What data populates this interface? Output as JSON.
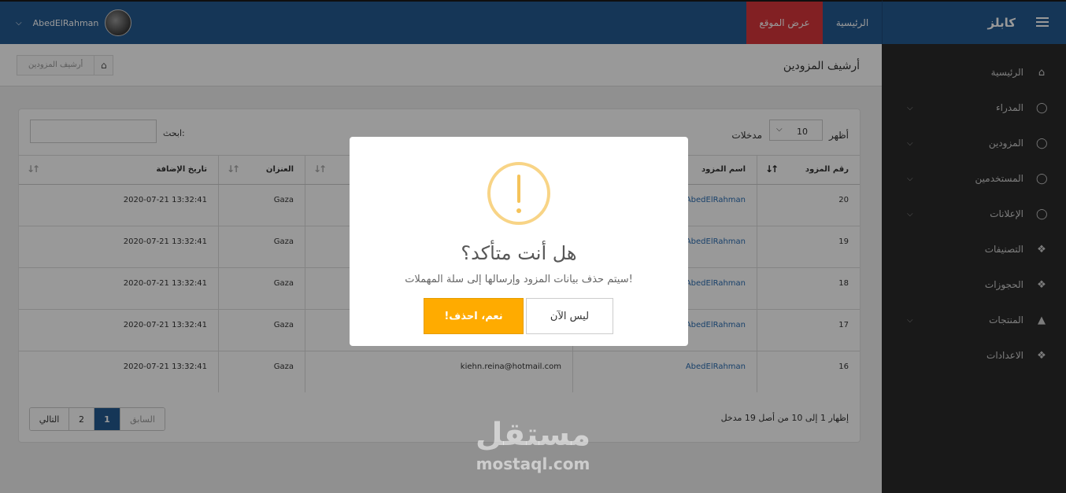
{
  "header": {
    "username": "AbedElRahman",
    "nav_site": "عرض الموقع",
    "nav_home": "الرئيسية"
  },
  "brand": "كابلز",
  "sidebar": {
    "items": [
      {
        "label": "الرئيسية",
        "icon": "home-icon",
        "has_children": false
      },
      {
        "label": "المدراء",
        "icon": "user-icon",
        "has_children": true
      },
      {
        "label": "المزودين",
        "icon": "user-icon",
        "has_children": true
      },
      {
        "label": "المستخدمين",
        "icon": "user-icon",
        "has_children": true
      },
      {
        "label": "الإعلانات",
        "icon": "user-icon",
        "has_children": true
      },
      {
        "label": "التصنيفات",
        "icon": "cubes-icon",
        "has_children": false
      },
      {
        "label": "الحجوزات",
        "icon": "cubes-icon",
        "has_children": false
      },
      {
        "label": "المنتجات",
        "icon": "flask-icon",
        "has_children": true
      },
      {
        "label": "الاعدادات",
        "icon": "cubes-icon",
        "has_children": false
      }
    ]
  },
  "page": {
    "title": "أرشيف المزودين",
    "breadcrumb": "أرشيف المزودين"
  },
  "table_controls": {
    "show_label": "أظهر",
    "page_size": "10",
    "entries_label": "مدخلات",
    "search_label": "ابحث:"
  },
  "table": {
    "headers": [
      "رقم المزود",
      "اسم المزود",
      "",
      "العنزان",
      "تاريخ الإضافة"
    ],
    "rows": [
      [
        "20",
        "AbedElRahman",
        "",
        "Gaza",
        "2020-07-21 13:32:41"
      ],
      [
        "19",
        "AbedElRahman",
        "",
        "Gaza",
        "2020-07-21 13:32:41"
      ],
      [
        "18",
        "AbedElRahman",
        "",
        "Gaza",
        "2020-07-21 13:32:41"
      ],
      [
        "17",
        "AbedElRahman",
        "",
        "Gaza",
        "2020-07-21 13:32:41"
      ],
      [
        "16",
        "AbedElRahman",
        "kiehn.reina@hotmail.com",
        "Gaza",
        "2020-07-21 13:32:41"
      ]
    ]
  },
  "pagination": {
    "info": "إظهار 1 إلى 10 من أصل 19 مدخل",
    "next": "التالي",
    "page2": "2",
    "page1": "1",
    "prev": "السابق"
  },
  "modal": {
    "title": "هل أنت متأكد؟",
    "text": "سيتم حذف بيانات المزود وإرسالها إلى سلة المهملات!",
    "confirm": "!نعم، احذف",
    "cancel": "ليس الآن"
  },
  "watermark": {
    "ar": "مستقل",
    "en": "mostaql.com"
  }
}
